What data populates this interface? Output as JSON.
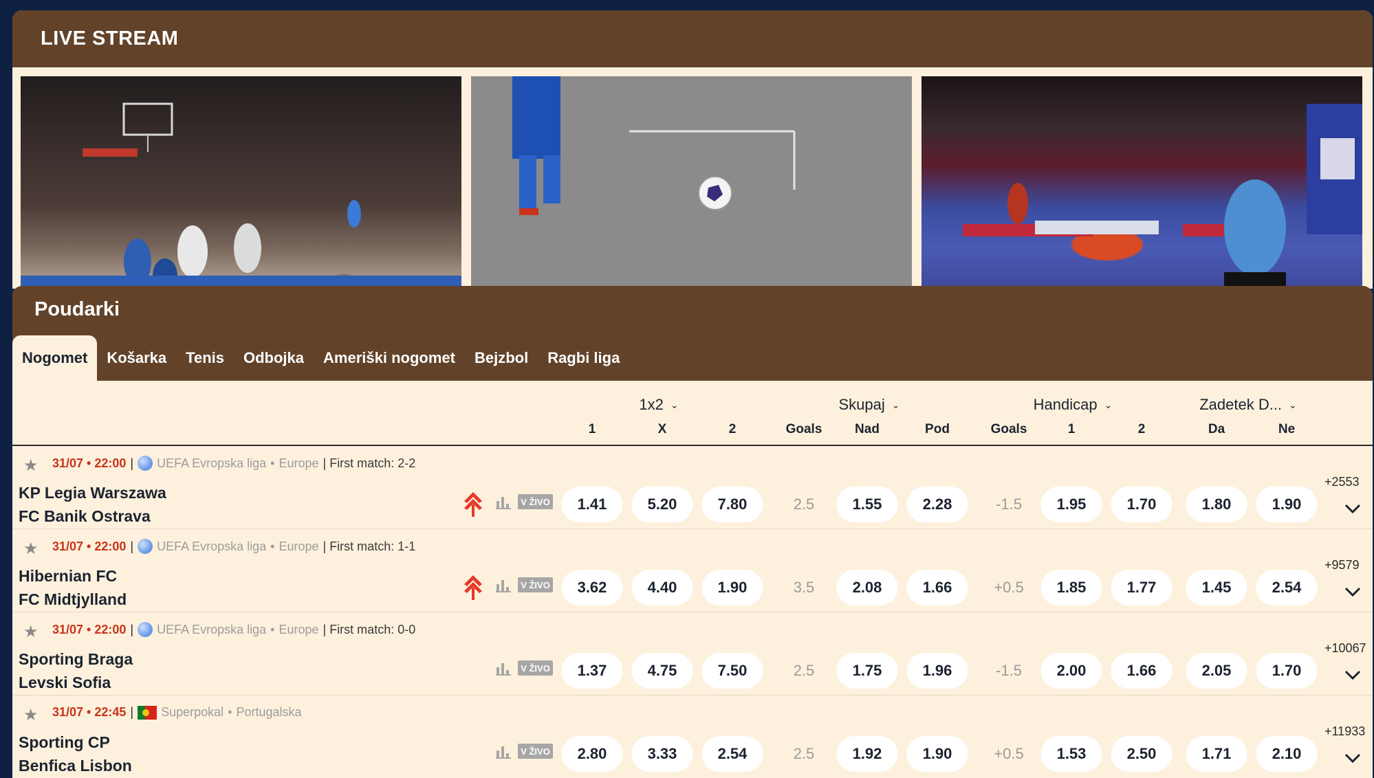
{
  "live": {
    "title": "LIVE STREAM",
    "streams": [
      {
        "sport": "basketball"
      },
      {
        "sport": "football"
      },
      {
        "sport": "table-tennis"
      }
    ]
  },
  "highlights": {
    "title": "Poudarki",
    "tabs": [
      "Nogomet",
      "Košarka",
      "Tenis",
      "Odbojka",
      "Ameriški nogomet",
      "Bejzbol",
      "Ragbi liga"
    ],
    "active_tab": "Nogomet",
    "markets": [
      {
        "title": "1x2",
        "cols": [
          "1",
          "X",
          "2"
        ]
      },
      {
        "title": "Skupaj",
        "cols": [
          "Goals",
          "Nad",
          "Pod"
        ]
      },
      {
        "title": "Handicap",
        "cols": [
          "Goals",
          "1",
          "2"
        ]
      },
      {
        "title": "Zadetek D...",
        "cols": [
          "Da",
          "Ne"
        ]
      }
    ],
    "live_label": "V ŽIVO",
    "matches": [
      {
        "time": "31/07 • 22:00",
        "league": "UEFA Evropska liga",
        "region": "Europe",
        "first_match": "| First match: 2-2",
        "home": "KP Legia Warszawa",
        "away": "FC Banik Ostrava",
        "trending": true,
        "odds_1x2": [
          "1.41",
          "5.20",
          "7.80"
        ],
        "total_line": "2.5",
        "total": [
          "1.55",
          "2.28"
        ],
        "hcp_line": "-1.5",
        "hcp": [
          "1.95",
          "1.70"
        ],
        "btts": [
          "1.80",
          "1.90"
        ],
        "more": "+2553"
      },
      {
        "time": "31/07 • 22:00",
        "league": "UEFA Evropska liga",
        "region": "Europe",
        "first_match": "| First match: 1-1",
        "home": "Hibernian FC",
        "away": "FC Midtjylland",
        "trending": true,
        "odds_1x2": [
          "3.62",
          "4.40",
          "1.90"
        ],
        "total_line": "3.5",
        "total": [
          "2.08",
          "1.66"
        ],
        "hcp_line": "+0.5",
        "hcp": [
          "1.85",
          "1.77"
        ],
        "btts": [
          "1.45",
          "2.54"
        ],
        "more": "+9579"
      },
      {
        "time": "31/07 • 22:00",
        "league": "UEFA Evropska liga",
        "region": "Europe",
        "first_match": "| First match: 0-0",
        "home": "Sporting Braga",
        "away": "Levski Sofia",
        "trending": false,
        "odds_1x2": [
          "1.37",
          "4.75",
          "7.50"
        ],
        "total_line": "2.5",
        "total": [
          "1.75",
          "1.96"
        ],
        "hcp_line": "-1.5",
        "hcp": [
          "2.00",
          "1.66"
        ],
        "btts": [
          "2.05",
          "1.70"
        ],
        "more": "+10067"
      },
      {
        "time": "31/07 • 22:45",
        "league": "Superpokal",
        "region": "Portugalska",
        "first_match": "",
        "home": "Sporting CP",
        "away": "Benfica Lisbon",
        "trending": false,
        "odds_1x2": [
          "2.80",
          "3.33",
          "2.54"
        ],
        "total_line": "2.5",
        "total": [
          "1.92",
          "1.90"
        ],
        "hcp_line": "+0.5",
        "hcp": [
          "1.53",
          "2.50"
        ],
        "btts": [
          "1.71",
          "2.10"
        ],
        "more": "+11933"
      }
    ]
  },
  "colors": {
    "brown": "#62432a",
    "cream": "#fdf1dd",
    "navy": "#0e2142",
    "time_red": "#c8331c"
  }
}
